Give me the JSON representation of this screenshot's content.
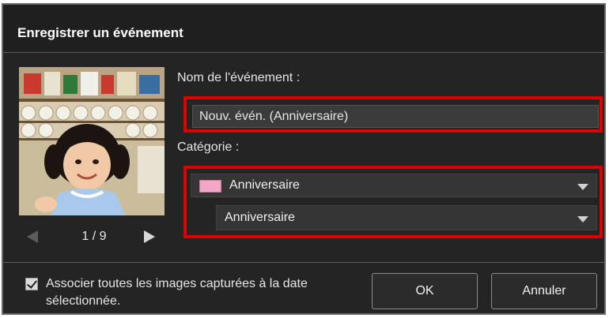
{
  "dialog": {
    "title": "Enregistrer un événement"
  },
  "thumbnail": {
    "pager": {
      "count": "1 / 9"
    },
    "prev_icon": "chevron-left-icon",
    "next_icon": "chevron-right-icon"
  },
  "event_name": {
    "label": "Nom de l'événement :",
    "value": "Nouv. évén. (Anniversaire)"
  },
  "category": {
    "label": "Catégorie :",
    "primary": {
      "value": "Anniversaire",
      "swatch_color": "#f2a6c8"
    },
    "secondary": {
      "value": "Anniversaire"
    }
  },
  "footer": {
    "checkbox_label": "Associer toutes les images capturées à la date sélectionnée.",
    "checkbox_checked": true,
    "ok_label": "OK",
    "cancel_label": "Annuler"
  },
  "colors": {
    "highlight": "#e00000",
    "dialog_bg": "#242424"
  }
}
